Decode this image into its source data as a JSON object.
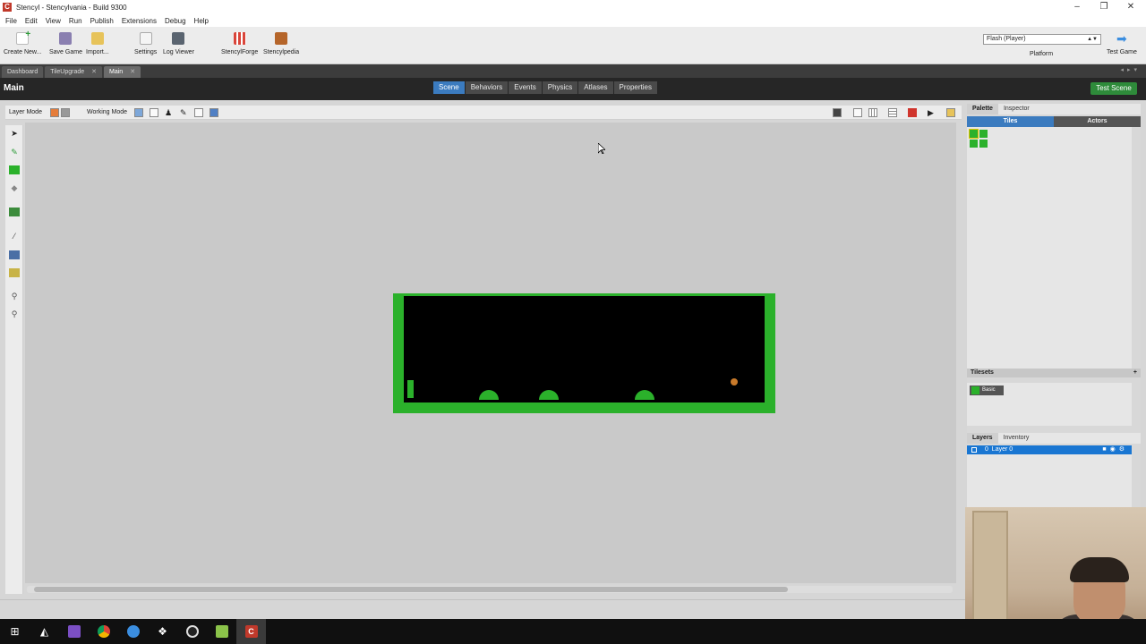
{
  "window": {
    "title": "Stencyl - Stencylvania - Build 9300",
    "app_icon": "stencyl-app-icon",
    "minimize": "–",
    "restore": "❐",
    "close": "✕"
  },
  "menu": [
    "File",
    "Edit",
    "View",
    "Run",
    "Publish",
    "Extensions",
    "Debug",
    "Help"
  ],
  "toolbar": {
    "create_new": "Create New...",
    "save_game": "Save Game",
    "import": "Import...",
    "settings": "Settings",
    "log_viewer": "Log Viewer",
    "stencylforge": "StencylForge",
    "stencylpedia": "Stencylpedia",
    "platform_value": "Flash (Player)",
    "platform_label": "Platform",
    "test_game": "Test Game"
  },
  "doc_tabs": [
    {
      "label": "Dashboard",
      "closable": false,
      "active": false
    },
    {
      "label": "TileUpgrade",
      "closable": true,
      "active": false
    },
    {
      "label": "Main",
      "closable": true,
      "active": true
    }
  ],
  "scene": {
    "name": "Main",
    "tabs": [
      "Scene",
      "Behaviors",
      "Events",
      "Physics",
      "Atlases",
      "Properties"
    ],
    "active_tab": "Scene",
    "test_scene": "Test Scene"
  },
  "scene_toolbar": {
    "layer_mode": "Layer Mode",
    "working_mode": "Working Mode"
  },
  "right_panel": {
    "tabs": [
      "Palette",
      "Inspector"
    ],
    "active_tab": "Palette",
    "subtabs": [
      "Tiles",
      "Actors"
    ],
    "active_subtab": "Tiles",
    "tilesets_header": "Tilesets",
    "tilesets": [
      {
        "name": "Basic",
        "color": "#2bb12b"
      }
    ],
    "layers_tabs": [
      "Layers",
      "Inventory"
    ],
    "layers": [
      {
        "index": "0",
        "name": "Layer 0"
      }
    ]
  },
  "colors": {
    "accent": "#3b7bbf",
    "green": "#2bb12b",
    "test_scene": "#2e8b3a",
    "selected_layer": "#1976d2"
  },
  "taskbar": [
    "windows-start-icon",
    "stencyl-launcher-icon",
    "visual-studio-icon",
    "chrome-icon",
    "browser-icon",
    "app-icon",
    "obs-icon",
    "notepad-icon",
    "stencyl-icon"
  ]
}
